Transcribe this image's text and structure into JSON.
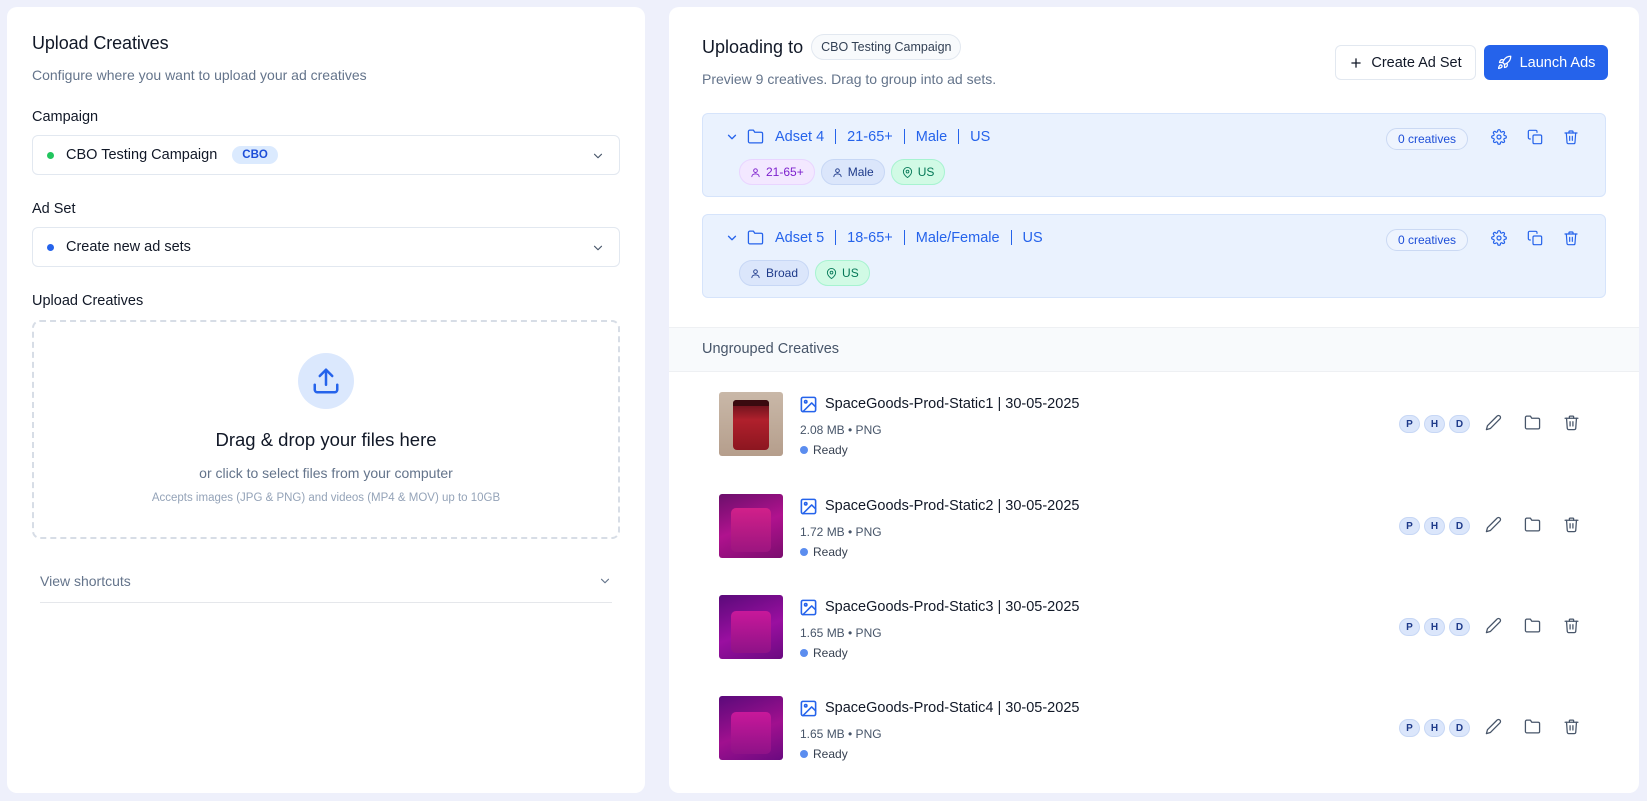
{
  "left": {
    "title": "Upload Creatives",
    "subtitle": "Configure where you want to upload your ad creatives",
    "campaign": {
      "label": "Campaign",
      "value": "CBO Testing Campaign",
      "badge": "CBO",
      "dot_color": "#22c55e"
    },
    "adset": {
      "label": "Ad Set",
      "value": "Create new ad sets",
      "dot_color": "#2563eb"
    },
    "upload": {
      "label": "Upload Creatives",
      "title": "Drag & drop your files here",
      "subtitle": "or click to select files from your computer",
      "note": "Accepts images (JPG & PNG) and videos (MP4 & MOV) up to 10GB"
    },
    "shortcuts_label": "View shortcuts"
  },
  "right": {
    "title": "Uploading to",
    "campaign_chip": "CBO Testing Campaign",
    "subtitle": "Preview 9 creatives. Drag to group into ad sets.",
    "create_button": "Create Ad Set",
    "launch_button": "Launch Ads",
    "adsets": [
      {
        "name": "Adset 4",
        "age": "21-65+",
        "gender": "Male",
        "geo": "US",
        "count": "0 creatives",
        "tags": [
          {
            "label": "21-65+",
            "style": "purple",
            "icon": "user-icon"
          },
          {
            "label": "Male",
            "style": "blue",
            "icon": "user-icon"
          },
          {
            "label": "US",
            "style": "green",
            "icon": "map-pin-icon"
          }
        ]
      },
      {
        "name": "Adset 5",
        "age": "18-65+",
        "gender": "Male/Female",
        "geo": "US",
        "count": "0 creatives",
        "tags": [
          {
            "label": "Broad",
            "style": "blue",
            "icon": "user-icon"
          },
          {
            "label": "US",
            "style": "green",
            "icon": "map-pin-icon"
          }
        ]
      }
    ],
    "ungrouped_title": "Ungrouped Creatives",
    "creatives": [
      {
        "name": "SpaceGoods-Prod-Static1 | 30-05-2025",
        "meta": "2.08 MB • PNG",
        "status": "Ready",
        "letters": [
          "P",
          "H",
          "D"
        ]
      },
      {
        "name": "SpaceGoods-Prod-Static2 | 30-05-2025",
        "meta": "1.72 MB • PNG",
        "status": "Ready",
        "letters": [
          "P",
          "H",
          "D"
        ]
      },
      {
        "name": "SpaceGoods-Prod-Static3 | 30-05-2025",
        "meta": "1.65 MB • PNG",
        "status": "Ready",
        "letters": [
          "P",
          "H",
          "D"
        ]
      },
      {
        "name": "SpaceGoods-Prod-Static4 | 30-05-2025",
        "meta": "1.65 MB • PNG",
        "status": "Ready",
        "letters": [
          "P",
          "H",
          "D"
        ]
      }
    ]
  },
  "colors": {
    "accent": "#2563eb",
    "background": "#eef0fb",
    "adset_bg": "#eaf2fe"
  }
}
